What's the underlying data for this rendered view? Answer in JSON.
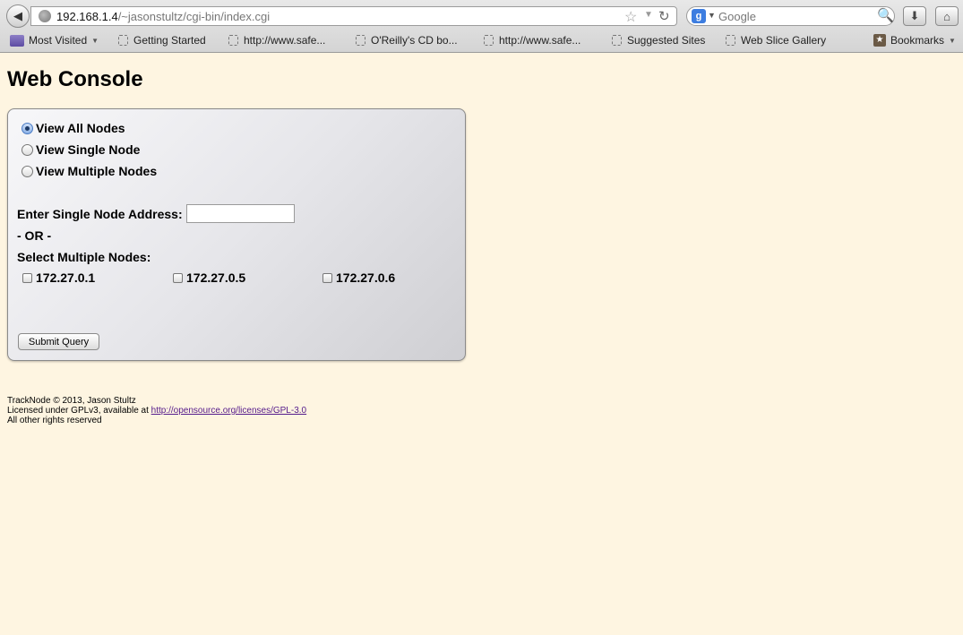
{
  "browser": {
    "url_host": "192.168.1.4",
    "url_path": "/~jasonstultz/cgi-bin/index.cgi",
    "search_placeholder": "Google",
    "bookmarks": [
      {
        "label": "Most Visited"
      },
      {
        "label": "Getting Started"
      },
      {
        "label": "http://www.safe..."
      },
      {
        "label": "O'Reilly's CD bo..."
      },
      {
        "label": "http://www.safe..."
      },
      {
        "label": "Suggested Sites"
      },
      {
        "label": "Web Slice Gallery"
      }
    ],
    "bookmarks_menu": "Bookmarks"
  },
  "page": {
    "title": "Web Console",
    "view_options": [
      {
        "label": "View All Nodes",
        "checked": true
      },
      {
        "label": "View Single Node",
        "checked": false
      },
      {
        "label": "View Multiple Nodes",
        "checked": false
      }
    ],
    "single_node_label": "Enter Single Node Address:",
    "single_node_value": "",
    "or_label": "- OR -",
    "multiple_nodes_label": "Select Multiple Nodes:",
    "nodes": [
      "172.27.0.1",
      "172.27.0.5",
      "172.27.0.6"
    ],
    "submit_label": "Submit Query"
  },
  "footer": {
    "line1": "TrackNode © 2013, Jason Stultz",
    "line2_prefix": "Licensed under GPLv3, available at ",
    "license_link": "http://opensource.org/licenses/GPL-3.0",
    "line3": "All other rights reserved"
  }
}
